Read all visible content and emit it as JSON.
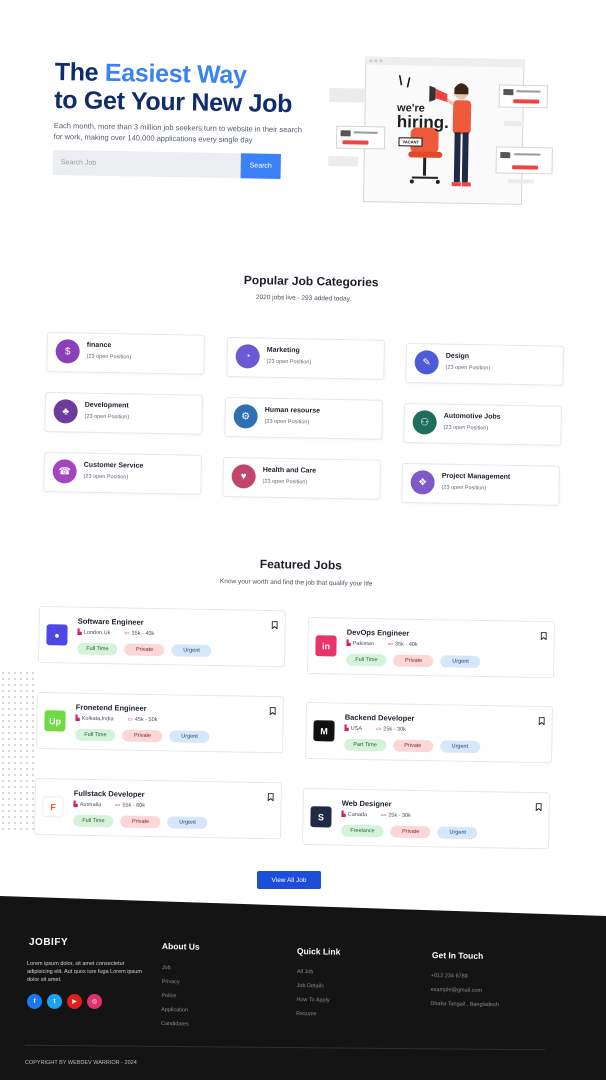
{
  "hero": {
    "title_part1": "The",
    "title_accent": "Easiest Way",
    "title_line2": "to Get Your New Job",
    "description": "Each month, more than 3 million job seekers turn to website in their search for work, making over 140,000 applications every single day",
    "search_placeholder": "Search Job",
    "search_button": "Search",
    "illustration": {
      "word1": "we're",
      "word2": "hiring.",
      "vacant": "VACANT"
    }
  },
  "categories": {
    "title": "Popular Job Categories",
    "subtitle": "2020 jobs live - 293 added today.",
    "items": [
      {
        "name": "finance",
        "count": "(23 open Position)",
        "icon": "finance-icon",
        "color": "#8b3fb8"
      },
      {
        "name": "Marketing",
        "count": "(23 open Position)",
        "icon": "marketing-icon",
        "color": "#6a5ad6"
      },
      {
        "name": "Design",
        "count": "(23 open Position)",
        "icon": "design-icon",
        "color": "#4d5bd8"
      },
      {
        "name": "Development",
        "count": "(23 open Position)",
        "icon": "development-icon",
        "color": "#6d3a9e"
      },
      {
        "name": "Human resourse",
        "count": "(23 open Position)",
        "icon": "human-resource-icon",
        "color": "#2f6fb5"
      },
      {
        "name": "Automotive Jobs",
        "count": "(23 open Position)",
        "icon": "automotive-icon",
        "color": "#1f6e5c"
      },
      {
        "name": "Customer Service",
        "count": "(23 open Position)",
        "icon": "customer-service-icon",
        "color": "#a645c0"
      },
      {
        "name": "Health and Care",
        "count": "(23 open Position)",
        "icon": "health-care-icon",
        "color": "#c2456a"
      },
      {
        "name": "Project Management",
        "count": "(23 open Position)",
        "icon": "project-management-icon",
        "color": "#7f58c9"
      }
    ]
  },
  "featured": {
    "title": "Featured Jobs",
    "subtitle": "Know your worth and find the job that qualify your life",
    "jobs": [
      {
        "title": "Software Engineer",
        "location": "London,Uk",
        "salary": "35k - 40k",
        "tags": [
          "Full Time",
          "Private",
          "Urgent"
        ],
        "logo_text": "●",
        "logo_color": "#4f46e5",
        "logo_icon": "software-company-logo-icon"
      },
      {
        "title": "DevOps Engineer",
        "location": "Pakistan",
        "salary": "35k - 40k",
        "tags": [
          "Full Time",
          "Private",
          "Urgent"
        ],
        "logo_text": "in",
        "logo_color": "#e8336b",
        "logo_icon": "invision-logo-icon"
      },
      {
        "title": "Fronetend Engineer",
        "location": "Kolkata,India",
        "salary": "45k - 50k",
        "tags": [
          "Full Time",
          "Private",
          "Urgent"
        ],
        "logo_text": "Up",
        "logo_color": "#6fda44",
        "logo_icon": "upwork-logo-icon"
      },
      {
        "title": "Backend Developer",
        "location": "USA",
        "salary": "25k - 30k",
        "tags": [
          "Part Time",
          "Private",
          "Urgent"
        ],
        "logo_text": "M",
        "logo_color": "#111111",
        "logo_icon": "medium-logo-icon"
      },
      {
        "title": "Fullstack Developer",
        "location": "Australia",
        "salary": "55k - 60k",
        "tags": [
          "Full Time",
          "Private",
          "Urgent"
        ],
        "logo_text": "F",
        "logo_color": "#ffffff",
        "logo_icon": "figma-logo-icon"
      },
      {
        "title": "Web Designer",
        "location": "Canada",
        "salary": "25k - 30k",
        "tags": [
          "Freelance",
          "Private",
          "Urgent"
        ],
        "logo_text": "S",
        "logo_color": "#1f2a44",
        "logo_icon": "web-design-logo-icon"
      }
    ],
    "view_all": "View All Job"
  },
  "footer": {
    "brand": "JOBIFY",
    "about": "Lorem ipsum dolor, sit amet consectetur adipisicing elit. Aut quos iure fuga Lorem ipsum dolor sit amet.",
    "social": [
      {
        "icon": "facebook-icon",
        "glyph": "f",
        "color": "#1877f2"
      },
      {
        "icon": "twitter-icon",
        "glyph": "t",
        "color": "#1da1f2"
      },
      {
        "icon": "youtube-icon",
        "glyph": "▶",
        "color": "#e11d1d"
      },
      {
        "icon": "instagram-icon",
        "glyph": "◎",
        "color": "#e1306c"
      }
    ],
    "about_us_title": "About Us",
    "about_us_links": [
      "Job",
      "Privacy",
      "Police",
      "Application",
      "Candidates"
    ],
    "quick_link_title": "Quick Link",
    "quick_links": [
      "All Job",
      "Job Details",
      "How To Apply",
      "Resume"
    ],
    "contact_title": "Get In Touch",
    "contact": [
      "+012 234 6789",
      "example@gmail.com",
      "Dhaka Tangail , Bangladesh"
    ],
    "copyright": "COPYRIGHT BY WEBDEV WARRIOR - 2024"
  }
}
